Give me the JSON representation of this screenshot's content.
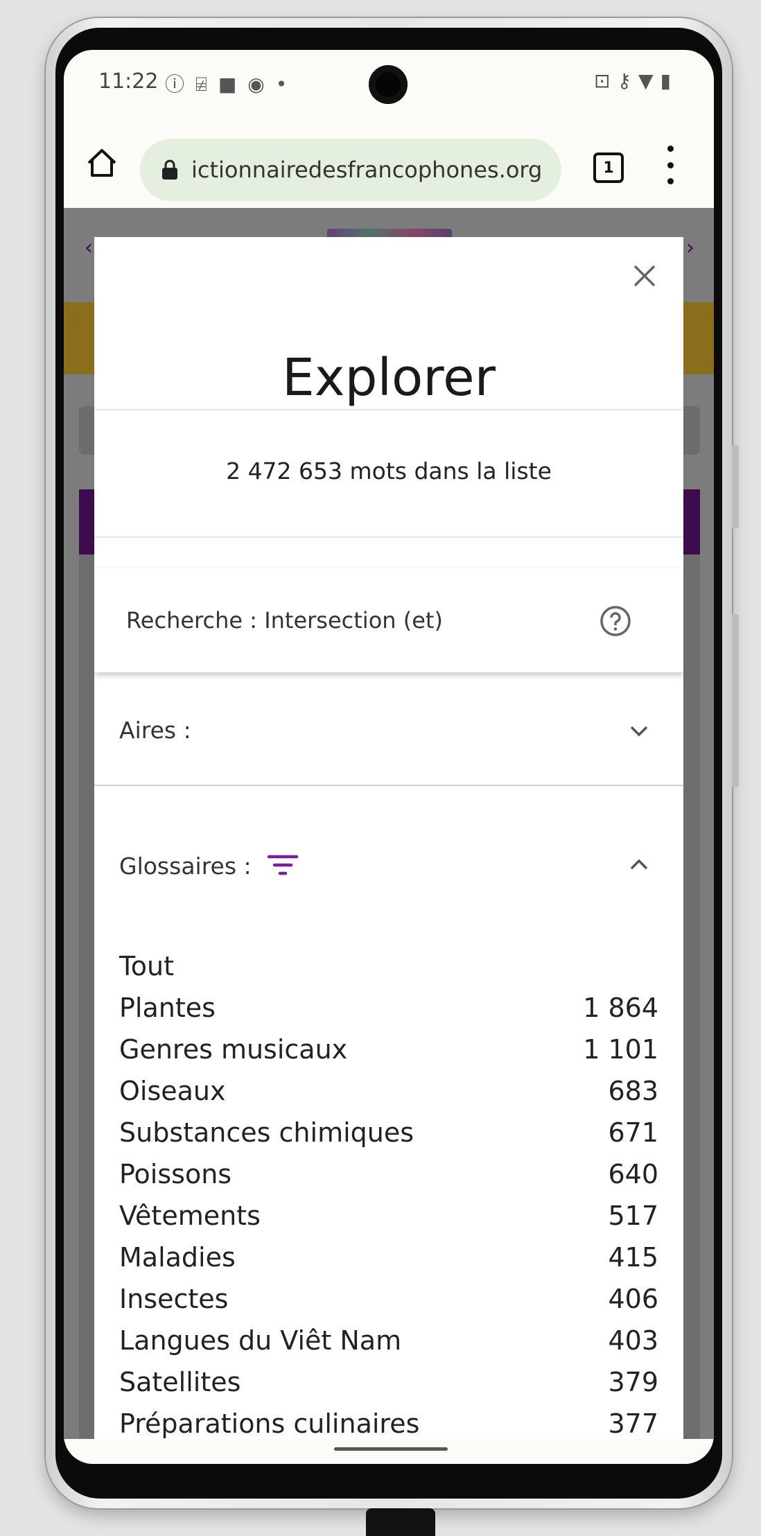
{
  "status_bar": {
    "time": "11:22",
    "left_icons": [
      "info-icon",
      "cpu-icon",
      "square-app-icon",
      "sync-app-icon",
      "dot-icon"
    ],
    "right_icons": [
      "cast-icon",
      "vpn-key-icon",
      "wifi-icon",
      "battery-charging-icon"
    ]
  },
  "browser": {
    "url": "ictionnairedesfrancophones.org",
    "tab_count": "1"
  },
  "modal": {
    "title": "Explorer",
    "word_count": "2 472 653 mots dans la liste",
    "search_mode": "Recherche : Intersection (et)",
    "aires_label": "Aires :",
    "glossaires_label": "Glossaires :",
    "glossaires": [
      {
        "label": "Tout",
        "count": ""
      },
      {
        "label": "Plantes",
        "count": "1 864"
      },
      {
        "label": "Genres musicaux",
        "count": "1 101"
      },
      {
        "label": "Oiseaux",
        "count": "683"
      },
      {
        "label": "Substances chimiques",
        "count": "671"
      },
      {
        "label": "Poissons",
        "count": "640"
      },
      {
        "label": "Vêtements",
        "count": "517"
      },
      {
        "label": "Maladies",
        "count": "415"
      },
      {
        "label": "Insectes",
        "count": "406"
      },
      {
        "label": "Langues du Viêt Nam",
        "count": "403"
      },
      {
        "label": "Satellites",
        "count": "379"
      },
      {
        "label": "Préparations culinaires",
        "count": "377"
      }
    ]
  },
  "colors": {
    "accent_purple": "#7b1fa2",
    "page_purple": "#3e0b4e",
    "page_yellow": "#8a6e1c"
  }
}
